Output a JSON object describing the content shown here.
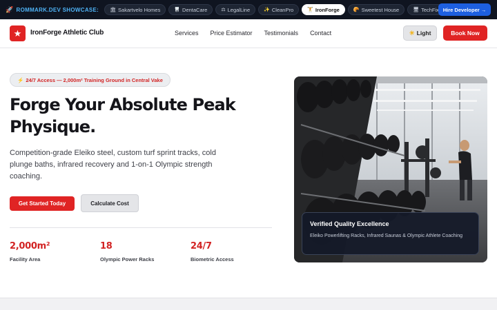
{
  "showcase": {
    "label": "ROMMARK.DEV SHOWCASE:",
    "rocket_icon": "rocket-icon",
    "chips": [
      {
        "icon": "🏛",
        "label": "Sakartvelo Homes",
        "active": false
      },
      {
        "icon": "🦷",
        "label": "DentaCare",
        "active": false
      },
      {
        "icon": "⚖",
        "label": "LegalLine",
        "active": false
      },
      {
        "icon": "✨",
        "label": "CleanPro",
        "active": false
      },
      {
        "icon": "🏋",
        "label": "IronForge",
        "active": true
      },
      {
        "icon": "🥐",
        "label": "Sweetest House",
        "active": false
      },
      {
        "icon": "🖥",
        "label": "TechFix",
        "active": false
      }
    ],
    "hire_label": "Hire Developer →"
  },
  "header": {
    "brand": "IronForge Athletic Club",
    "nav": [
      "Services",
      "Price Estimator",
      "Testimonials",
      "Contact"
    ],
    "theme_label": "Light",
    "book_label": "Book Now"
  },
  "hero": {
    "pill": "24/7 Access — 2,000m² Training Ground in Central Vake",
    "title": "Forge Your Absolute Peak Physique.",
    "subtitle": "Competition-grade Eleiko steel, custom turf sprint tracks, cold plunge baths, infrared recovery and 1-on-1 Olympic strength coaching.",
    "cta_primary": "Get Started Today",
    "cta_secondary": "Calculate Cost",
    "stats": [
      {
        "value": "2,000m²",
        "label": "Facility Area"
      },
      {
        "value": "18",
        "label": "Olympic Power Racks"
      },
      {
        "value": "24/7",
        "label": "Biometric Access"
      }
    ]
  },
  "image_card": {
    "title": "Verified Quality Excellence",
    "text": "Eleiko Powerlifting Racks, Infrared Saunas & Olympic Athlete Coaching"
  },
  "colors": {
    "accent": "#e02424",
    "dark": "#0f1420",
    "hire": "#1d5fe0"
  }
}
